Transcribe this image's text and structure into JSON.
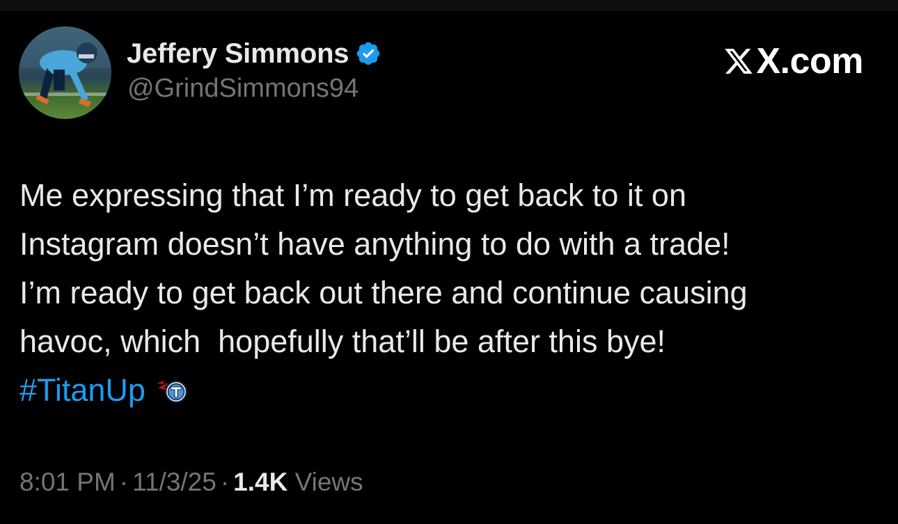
{
  "author": {
    "display_name": "Jeffery Simmons",
    "handle": "@GrindSimmons94",
    "verified": true,
    "avatar_icon": "football-player-avatar"
  },
  "brand": {
    "label": "X.com",
    "icon": "x-logo-icon"
  },
  "tweet": {
    "lines": [
      "Me expressing that I’m ready to get back to it on",
      "Instagram doesn’t have anything to do with a trade!",
      "I’m ready to get back out there and continue causing",
      "havoc, which  hopefully that’ll be after this bye!"
    ],
    "hashtag": "#TitanUp",
    "emoji_icon": "titans-logo-icon"
  },
  "meta": {
    "time": "8:01 PM",
    "date": "11/3/25",
    "separator": "·",
    "views_count": "1.4K",
    "views_label": "Views"
  },
  "colors": {
    "background": "#000000",
    "text": "#e7e9ea",
    "secondary": "#71767b",
    "link": "#1d9bf0",
    "verified": "#1d9bf0"
  }
}
